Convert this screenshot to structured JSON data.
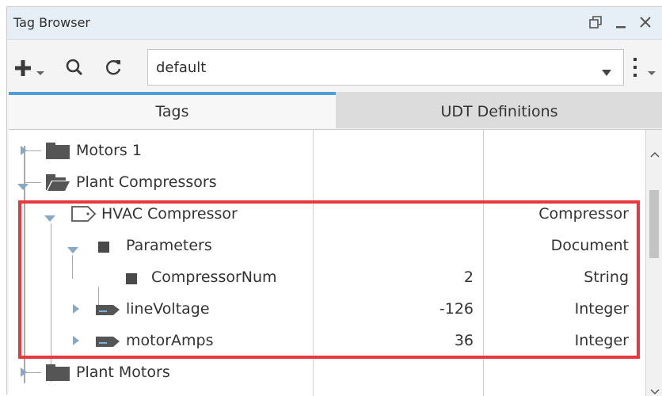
{
  "window": {
    "title": "Tag Browser",
    "controls": [
      "restore-icon",
      "minimize-icon",
      "close-icon"
    ]
  },
  "toolbar": {
    "add_icon": "plus-icon",
    "search_icon": "search-icon",
    "refresh_icon": "refresh-icon",
    "provider_value": "default",
    "more_icon": "vertical-dots-icon"
  },
  "tabs": [
    {
      "label": "Tags",
      "active": true
    },
    {
      "label": "UDT Definitions",
      "active": false
    }
  ],
  "tree": {
    "rows": [
      {
        "label": "Motors 1",
        "value": "",
        "type": "",
        "icon": "folder-icon",
        "expanded": false
      },
      {
        "label": "Plant Compressors",
        "value": "",
        "type": "",
        "icon": "folder-open-icon",
        "expanded": true
      },
      {
        "label": "HVAC Compressor",
        "value": "",
        "type": "Compressor",
        "icon": "udt-instance-icon",
        "expanded": true
      },
      {
        "label": "Parameters",
        "value": "",
        "type": "Document",
        "icon": "parameter-icon",
        "expanded": true
      },
      {
        "label": "CompressorNum",
        "value": "2",
        "type": "String",
        "icon": "parameter-icon",
        "expanded": false
      },
      {
        "label": "lineVoltage",
        "value": "-126",
        "type": "Integer",
        "icon": "opc-tag-icon",
        "expanded": false
      },
      {
        "label": "motorAmps",
        "value": "36",
        "type": "Integer",
        "icon": "opc-tag-icon",
        "expanded": false
      },
      {
        "label": "Plant Motors",
        "value": "",
        "type": "",
        "icon": "folder-icon",
        "expanded": false
      }
    ]
  },
  "colors": {
    "highlight": "#e8383d",
    "tab_accent": "#4c9fd7",
    "titlebar": "#e6eef6"
  }
}
